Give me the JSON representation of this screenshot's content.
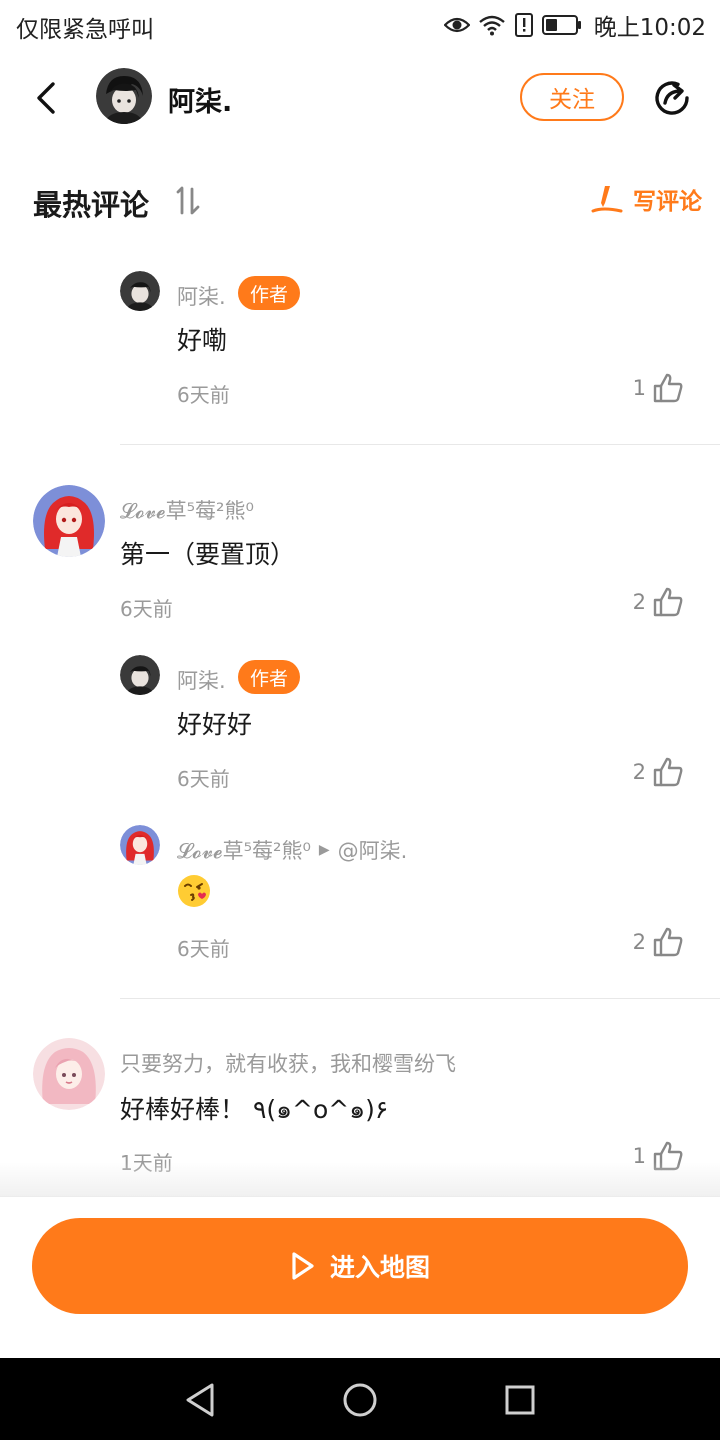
{
  "status_bar": {
    "carrier_text": "仅限紧急呼叫",
    "time": "晚上10:02",
    "icons": [
      "eye-icon",
      "wifi-icon",
      "alert-icon",
      "battery-icon"
    ]
  },
  "header": {
    "back_icon": "chevron-left-icon",
    "user_name": "阿柒.",
    "follow_label": "关注",
    "share_icon": "share-icon"
  },
  "comments_section": {
    "title": "最热评论",
    "sort_icon": "sort-icon",
    "write_label": "写评论",
    "write_icon": "pen-icon"
  },
  "comments": [
    {
      "name": "阿柒.",
      "badge": "作者",
      "text": "好嘞",
      "time": "6天前",
      "likes": "1"
    },
    {
      "name": "𝓛𝓸𝓿𝓮草⁵莓²熊⁰",
      "text": "第一（要置顶）",
      "time": "6天前",
      "likes": "2",
      "replies": [
        {
          "name": "阿柒.",
          "badge": "作者",
          "text": "好好好",
          "time": "6天前",
          "likes": "2"
        },
        {
          "name": "𝓛𝓸𝓿𝓮草⁵莓²熊⁰",
          "reply_arrow": "▶",
          "reply_to": "@阿柒.",
          "emoji": "kissing-face-emoji",
          "time": "6天前",
          "likes": "2"
        }
      ]
    },
    {
      "name": "只要努力，就有收获，我和樱雪纷飞",
      "text": "好棒好棒！ ٩(๑^o^๑)۶",
      "time": "1天前",
      "likes": "1"
    }
  ],
  "bottom": {
    "enter_map_label": "进入地图",
    "enter_map_icon": "play-icon"
  },
  "nav_bar": {
    "icons": [
      "back-triangle-icon",
      "home-circle-icon",
      "recents-square-icon"
    ]
  },
  "colors": {
    "accent": "#ff7a1a",
    "secondary_text": "#9a9a9a",
    "primary_text": "#1a1a1a"
  }
}
